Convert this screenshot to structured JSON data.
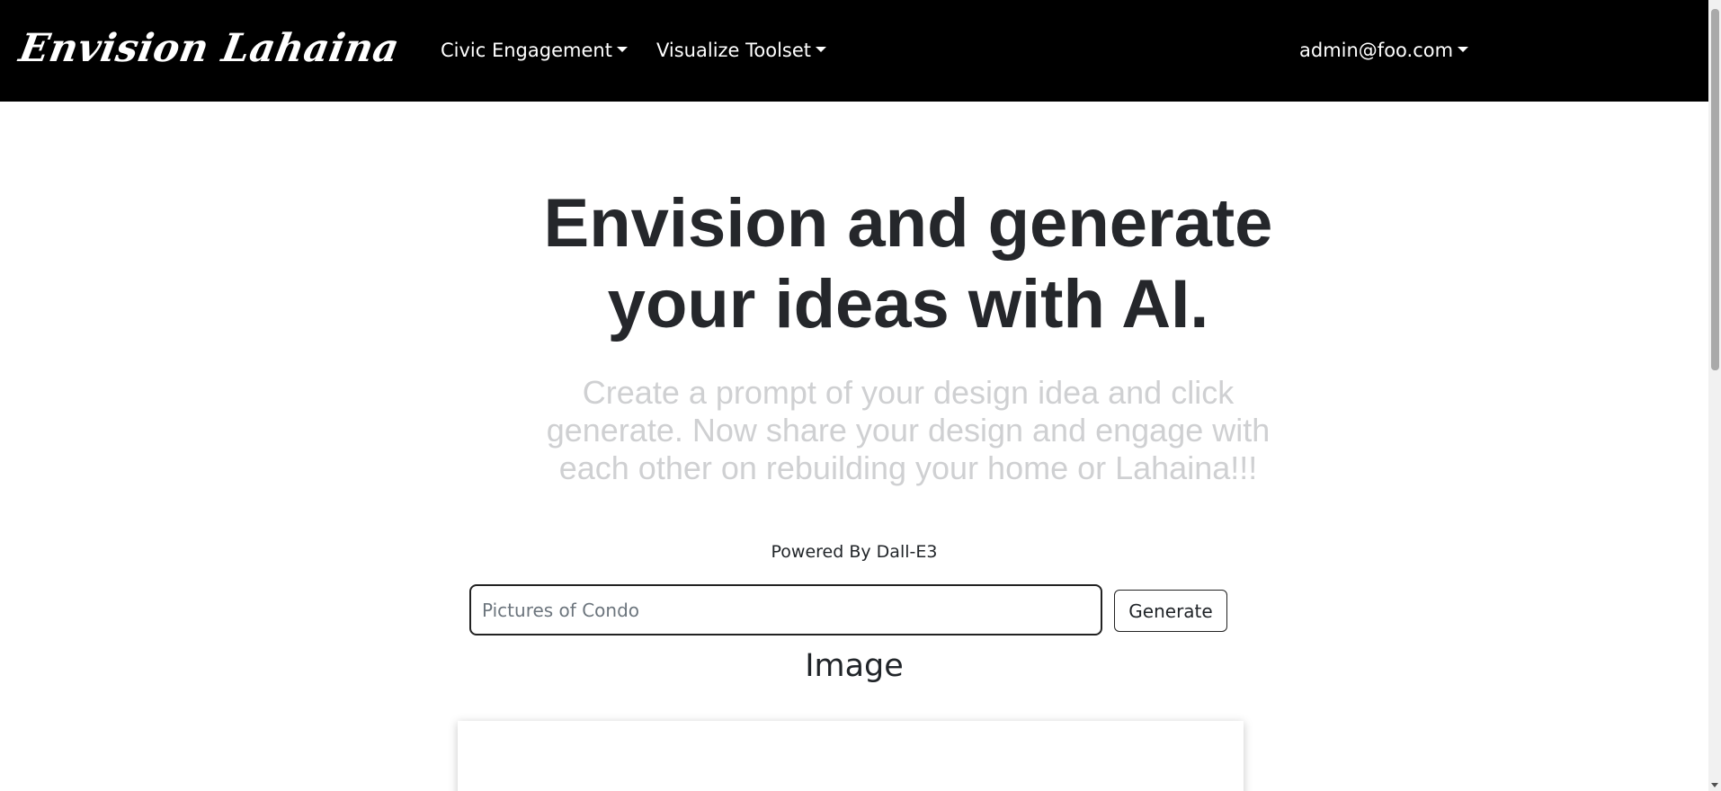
{
  "navbar": {
    "brand": "Envision Lahaina",
    "civic_engagement": "Civic Engagement",
    "visualize_toolset": "Visualize Toolset",
    "user_email": "admin@foo.com"
  },
  "hero": {
    "title_line1": "Envision and generate",
    "title_line2": "your ideas with AI.",
    "subtitle_line1": "Create a prompt of your design idea and click",
    "subtitle_line2": "generate. Now share your design and engage with",
    "subtitle_line3": "each other on rebuilding your home or Lahaina!!!"
  },
  "generator": {
    "powered_by": "Powered By Dall-E3",
    "prompt_placeholder": "Pictures of Condo",
    "prompt_value": "",
    "generate_label": "Generate",
    "image_heading": "Image"
  },
  "colors": {
    "navbar_bg": "#000000",
    "title": "#25272b",
    "subtitle": "#cfd0d2"
  }
}
